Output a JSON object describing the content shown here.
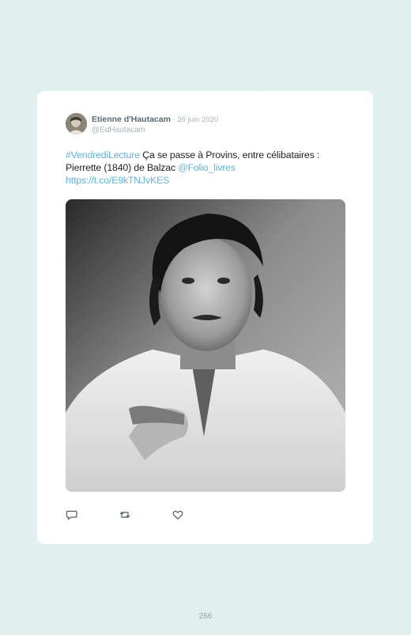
{
  "tweet": {
    "author_name": "Etienne d'Hautacam",
    "separator": " · ",
    "date": "26 juin 2020",
    "handle": "@EdHautacam",
    "hashtag": "#VendrediLecture",
    "text_part1": " Ça se passe à Provins, entre célibataires : Pierrette (1840) de Balzac ",
    "mention": "@Folio_livres",
    "url": "https://t.co/E9kTNJvKES"
  },
  "actions": {
    "reply_icon": "reply-icon",
    "retweet_icon": "retweet-icon",
    "like_icon": "heart-icon"
  },
  "page": {
    "number": "266"
  },
  "colors": {
    "background": "#dff0ef",
    "card": "#ffffff",
    "link": "#5cb6dd",
    "muted": "#a6b3b8"
  }
}
